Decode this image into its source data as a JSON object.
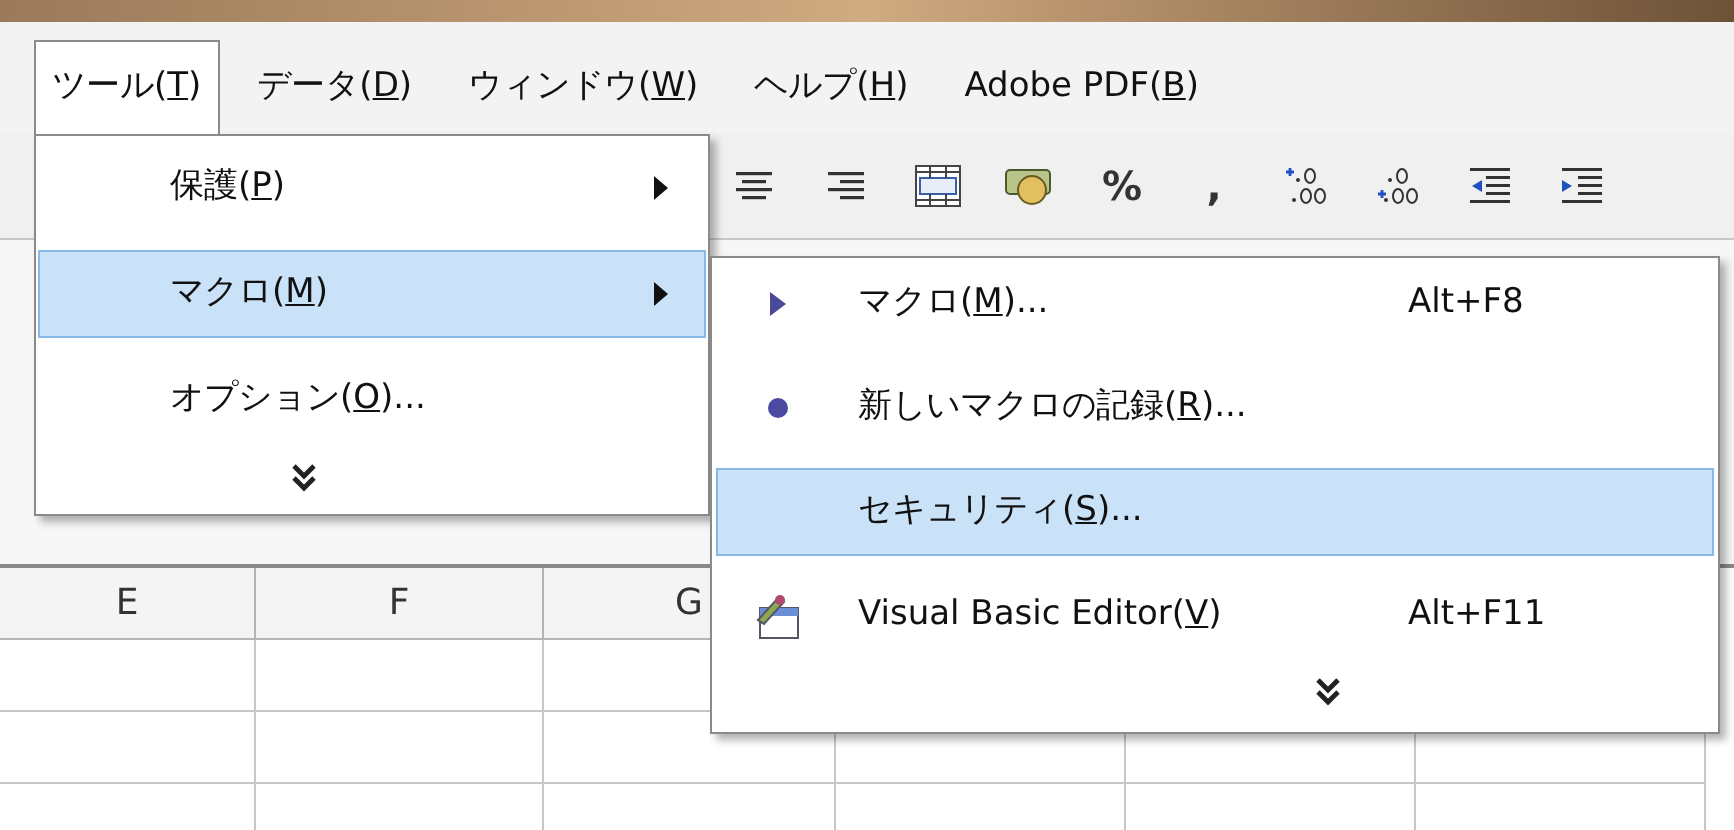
{
  "menu_bar": [
    {
      "before": "ツール(",
      "mnemonic": "T",
      "after": ")",
      "selected": true
    },
    {
      "before": "データ(",
      "mnemonic": "D",
      "after": ")",
      "selected": false
    },
    {
      "before": "ウィンドウ(",
      "mnemonic": "W",
      "after": ")",
      "selected": false
    },
    {
      "before": "ヘルプ(",
      "mnemonic": "H",
      "after": ")",
      "selected": false
    },
    {
      "before": "Adobe PDF(",
      "mnemonic": "B",
      "after": ")",
      "selected": false
    }
  ],
  "toolbar": [
    {
      "kind": "align-center"
    },
    {
      "kind": "align-right"
    },
    {
      "kind": "merge"
    },
    {
      "kind": "currency"
    },
    {
      "kind": "text",
      "label": "%"
    },
    {
      "kind": "text",
      "label": ","
    },
    {
      "kind": "increase-decimal"
    },
    {
      "kind": "decrease-decimal"
    },
    {
      "kind": "outdent"
    },
    {
      "kind": "indent"
    }
  ],
  "tools_menu": {
    "items": [
      {
        "before": "保護(",
        "mnemonic": "P",
        "after": ")",
        "submenu": true,
        "selected": false
      },
      {
        "before": "マクロ(",
        "mnemonic": "M",
        "after": ")",
        "submenu": true,
        "selected": true
      },
      {
        "before": "オプション(",
        "mnemonic": "O",
        "after": ")...",
        "submenu": false,
        "selected": false
      }
    ],
    "more": true
  },
  "macro_submenu": {
    "items": [
      {
        "kind": "run",
        "before": "マクロ(",
        "mnemonic": "M",
        "after": ")...",
        "shortcut": "Alt+F8",
        "selected": false
      },
      {
        "kind": "record",
        "before": "新しいマクロの記録(",
        "mnemonic": "R",
        "after": ")...",
        "selected": false
      },
      {
        "kind": "plain",
        "before": "セキュリティ(",
        "mnemonic": "S",
        "after": ")...",
        "selected": true
      },
      {
        "kind": "editor",
        "before": "Visual Basic Editor(",
        "mnemonic": "V",
        "after": ")",
        "shortcut": "Alt+F11",
        "selected": false
      }
    ],
    "more": true
  },
  "sheet": {
    "columns": [
      "E",
      "F",
      "G"
    ]
  }
}
